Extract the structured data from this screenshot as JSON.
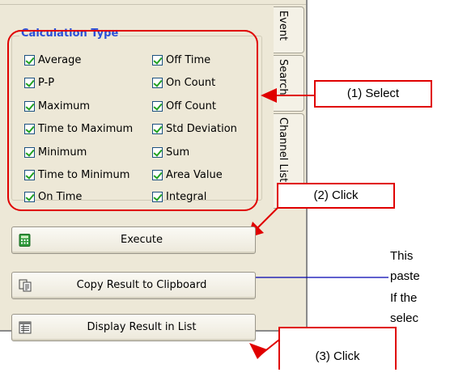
{
  "tabs": [
    "Event",
    "Search",
    "Channel List"
  ],
  "group": {
    "title": "Calculation Type",
    "left_items": [
      "Average",
      "P-P",
      "Maximum",
      "Time to Maximum",
      "Minimum",
      "Time to Minimum",
      "On Time"
    ],
    "right_items": [
      "Off Time",
      "On Count",
      "Off Count",
      "Std Deviation",
      "Sum",
      "Area Value",
      "Integral"
    ]
  },
  "buttons": {
    "execute": "Execute",
    "copy": "Copy Result to Clipboard",
    "display": "Display Result in List"
  },
  "annotations": {
    "select": "(1) Select",
    "click2": "(2) Click",
    "click3": "(3) Click",
    "note1_line1": "This",
    "note1_line2": "paste",
    "note2_line1": "If the",
    "note2_line2": "selec"
  },
  "colors": {
    "accent_red": "#e00000",
    "group_title": "#2b4fd8",
    "check": "#21a121"
  }
}
